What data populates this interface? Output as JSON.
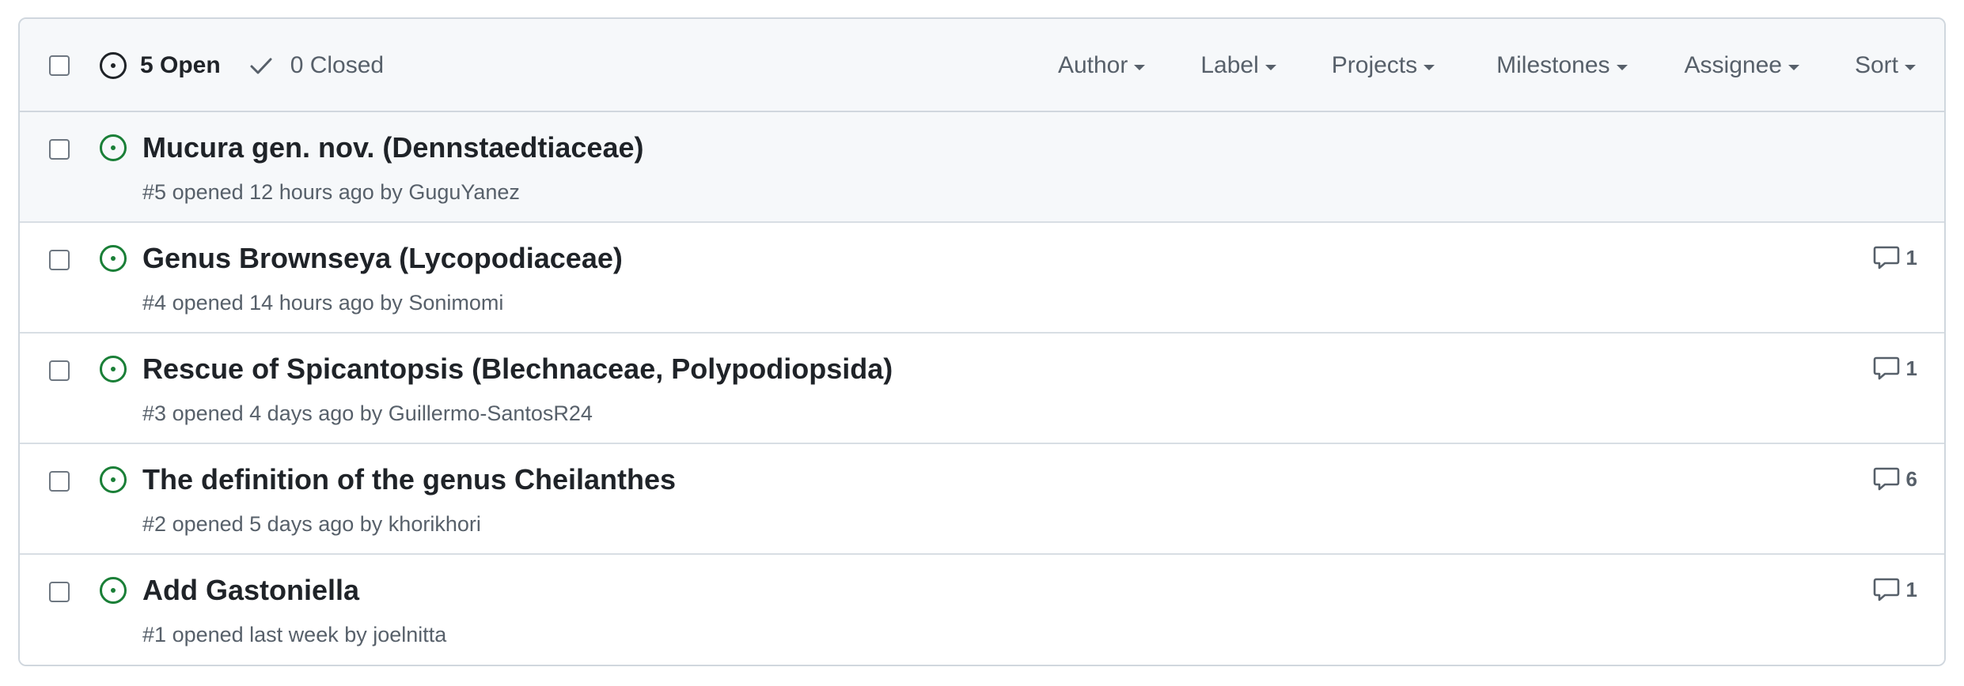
{
  "header": {
    "open_label": "5 Open",
    "closed_label": "0 Closed",
    "filters": [
      "Author",
      "Label",
      "Projects",
      "Milestones",
      "Assignee",
      "Sort"
    ]
  },
  "colors": {
    "open_icon": "#1a7f37",
    "border": "#d0d7de",
    "header_bg": "#f6f8fa"
  },
  "issues": [
    {
      "title": "Mucura gen. nov. (Dennstaedtiaceae)",
      "number": "#5",
      "opened": "opened 12 hours ago by",
      "author": "GuguYanez",
      "comments": ""
    },
    {
      "title": "Genus Brownseya (Lycopodiaceae)",
      "number": "#4",
      "opened": "opened 14 hours ago by",
      "author": "Sonimomi",
      "comments": "1"
    },
    {
      "title": "Rescue of Spicantopsis (Blechnaceae, Polypodiopsida)",
      "number": "#3",
      "opened": "opened 4 days ago by",
      "author": "Guillermo-SantosR24",
      "comments": "1"
    },
    {
      "title": "The definition of the genus Cheilanthes",
      "number": "#2",
      "opened": "opened 5 days ago by",
      "author": "khorikhori",
      "comments": "6"
    },
    {
      "title": "Add Gastoniella",
      "number": "#1",
      "opened": "opened last week by",
      "author": "joelnitta",
      "comments": "1"
    }
  ]
}
